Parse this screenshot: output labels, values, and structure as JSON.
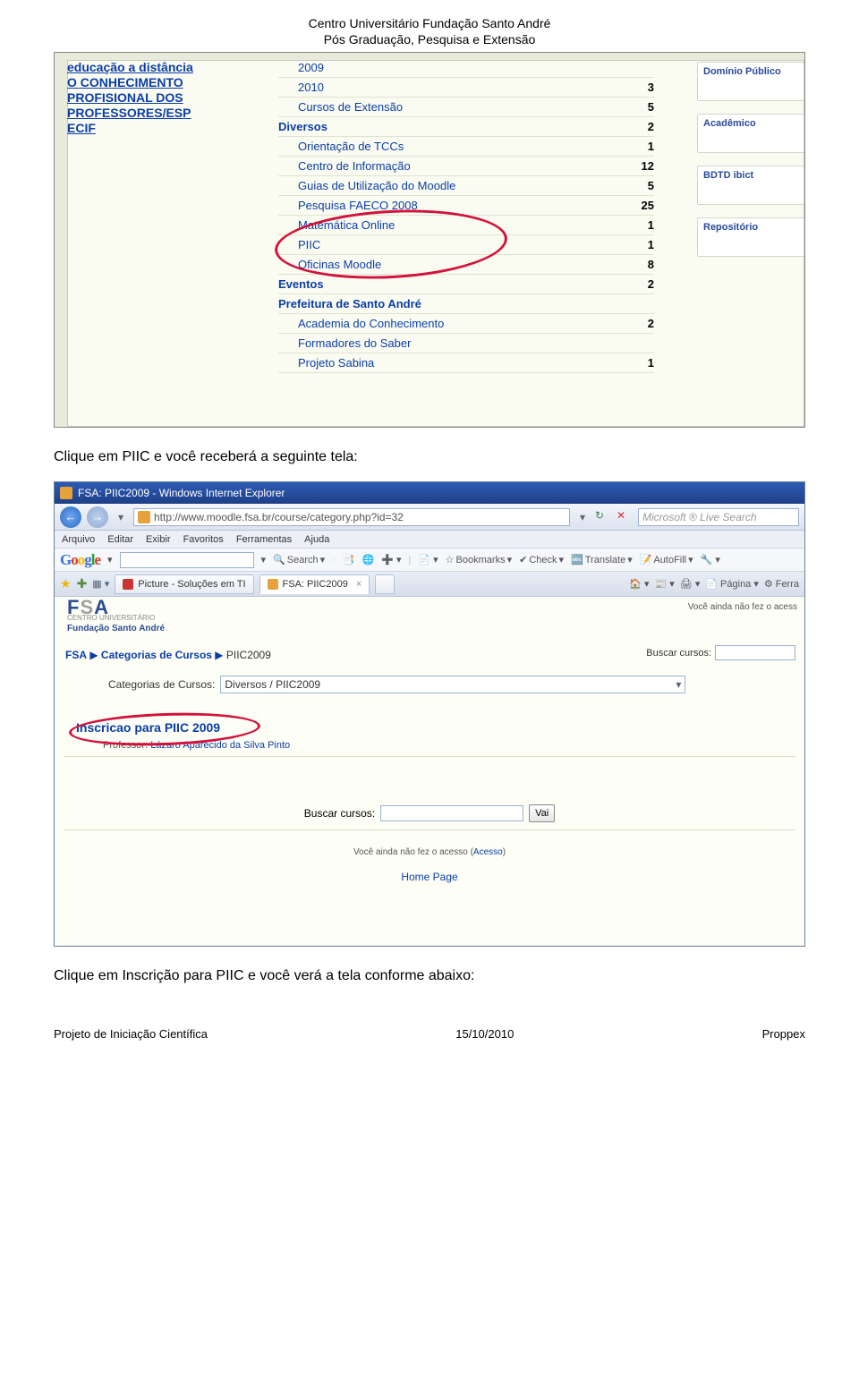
{
  "doc_header": {
    "line1": "Centro Universitário Fundação Santo André",
    "line2": "Pós Graduação, Pesquisa e Extensão"
  },
  "body_text_1": "Clique em PIIC e você receberá a seguinte tela:",
  "body_text_2": "Clique em Inscrição para PIIC e você verá a tela conforme abaixo:",
  "footer": {
    "left": "Projeto de Iniciação Científica",
    "center": "15/10/2010",
    "right": "Proppex"
  },
  "shot1": {
    "side_lines": [
      "educação a distância",
      "O CONHECIMENTO",
      "PROFISIONAL DOS",
      "PROFESSORES/ESP",
      "ECIF"
    ],
    "rows": [
      {
        "indent": 1,
        "label": "2009",
        "bold": false,
        "count": ""
      },
      {
        "indent": 1,
        "label": "2010",
        "bold": false,
        "count": "3"
      },
      {
        "indent": 1,
        "label": "Cursos de Extensão",
        "bold": false,
        "count": "5"
      },
      {
        "indent": 0,
        "label": "Diversos",
        "bold": true,
        "count": "2"
      },
      {
        "indent": 1,
        "label": "Orientação de TCCs",
        "bold": false,
        "count": "1"
      },
      {
        "indent": 1,
        "label": "Centro de Informação",
        "bold": false,
        "count": "12"
      },
      {
        "indent": 1,
        "label": "Guias de Utilização do Moodle",
        "bold": false,
        "count": "5"
      },
      {
        "indent": 1,
        "label": "Pesquisa FAECO 2008",
        "bold": false,
        "count": "25"
      },
      {
        "indent": 1,
        "label": "Matemática Online",
        "bold": false,
        "count": "1"
      },
      {
        "indent": 1,
        "label": "PIIC",
        "bold": false,
        "count": "1"
      },
      {
        "indent": 1,
        "label": "Oficinas Moodle",
        "bold": false,
        "count": "8"
      },
      {
        "indent": 0,
        "label": "Eventos",
        "bold": true,
        "count": "2"
      },
      {
        "indent": 0,
        "label": "Prefeitura de Santo André",
        "bold": true,
        "count": ""
      },
      {
        "indent": 1,
        "label": "Academia do Conhecimento",
        "bold": false,
        "count": "2"
      },
      {
        "indent": 1,
        "label": "Formadores do Saber",
        "bold": false,
        "count": ""
      },
      {
        "indent": 1,
        "label": "Projeto Sabina",
        "bold": false,
        "count": "1"
      }
    ],
    "badges": [
      "Domínio Público",
      "Acadêmico",
      "BDTD ibict",
      "Repositório"
    ]
  },
  "shot2": {
    "title": "FSA: PIIC2009 - Windows Internet Explorer",
    "url": "http://www.moodle.fsa.br/course/category.php?id=32",
    "search_placeholder": "Microsoft ® Live Search",
    "menubar": [
      "Arquivo",
      "Editar",
      "Exibir",
      "Favoritos",
      "Ferramentas",
      "Ajuda"
    ],
    "google_toolbar": {
      "items": [
        "Search",
        "Bookmarks",
        "Check",
        "Translate",
        "AutoFill"
      ]
    },
    "tabs": {
      "tab1": "Picture - Soluções em TI",
      "tab2": "FSA: PIIC2009",
      "tools": {
        "pagina": "Página",
        "ferra": "Ferra"
      }
    },
    "page": {
      "access_top": "Você ainda não fez o acess",
      "logo_sub1": "CENTRO UNIVERSITÁRIO",
      "logo_sub2": "Fundação Santo André",
      "breadcrumb": {
        "a": "FSA",
        "b": "Categorias de Cursos",
        "c": "PIIC2009"
      },
      "buscar_label": "Buscar cursos:",
      "cat_label": "Categorias de Cursos:",
      "cat_value": "Diversos / PIIC2009",
      "inscricao": "Inscricao para PIIC 2009",
      "professor_label": "Professor:",
      "professor_name": "Lázaro Aparecido da Silva Pinto",
      "vai": "Vai",
      "access_mid": "Você ainda não fez o acesso",
      "access_link": "Acesso",
      "home": "Home Page"
    }
  }
}
